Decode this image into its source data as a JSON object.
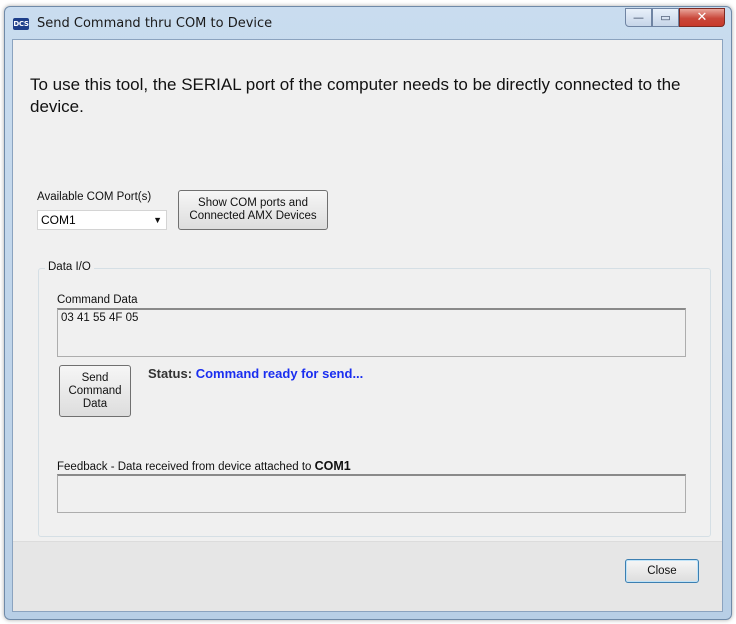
{
  "window": {
    "app_icon_text": "DCS",
    "title": "Send Command thru COM to Device",
    "minimize_glyph": "—",
    "maximize_glyph": "▭",
    "close_glyph": "✕"
  },
  "intro_text": "To use this tool, the SERIAL port of the computer needs to be directly connected to the device.",
  "com_port": {
    "label": "Available COM Port(s)",
    "selected": "COM1",
    "dropdown_icon": "chevron-down-icon"
  },
  "show_ports_button": {
    "line1": "Show COM ports and",
    "line2": "Connected AMX Devices"
  },
  "data_io": {
    "group_label": "Data I/O",
    "command_label": "Command Data",
    "command_value": "03 41 55 4F 05",
    "send_button": {
      "line1": "Send",
      "line2": "Command",
      "line3": "Data"
    },
    "status_label": "Status:",
    "status_value": "Command ready for send...",
    "feedback_label": "Feedback - Data received from device attached to",
    "feedback_port": "COM1",
    "feedback_value": ""
  },
  "close_button": "Close",
  "colors": {
    "status_value": "#1a2ef0",
    "titlebar": "#c9dcef",
    "close_caption": "#c7392b"
  }
}
